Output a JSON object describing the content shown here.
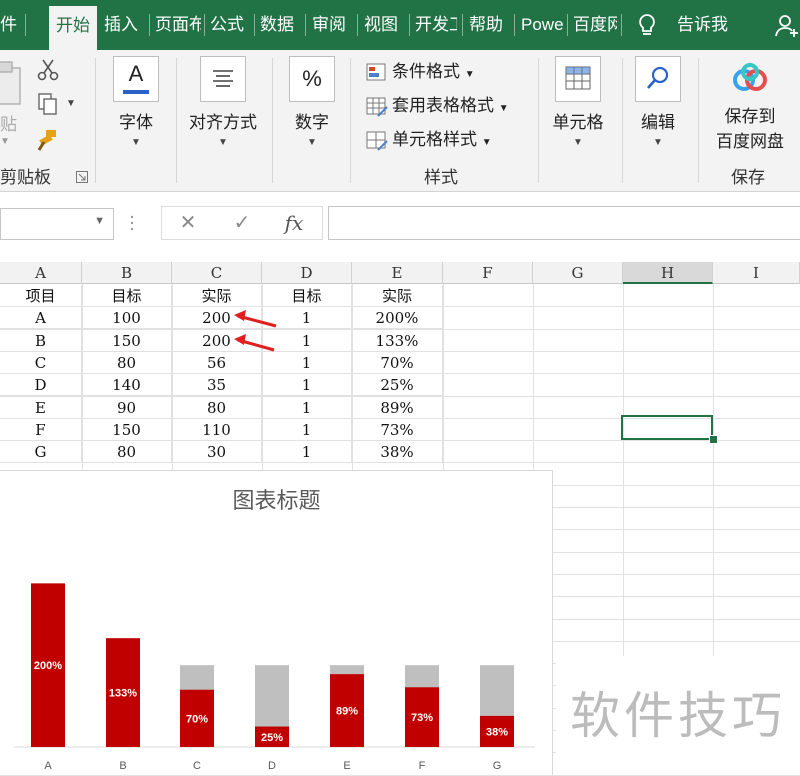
{
  "ribbon_tabs": [
    "件",
    "开始",
    "插入",
    "页面布",
    "公式",
    "数据",
    "审阅",
    "视图",
    "开发工",
    "帮助",
    "Powe",
    "百度网",
    "告诉我"
  ],
  "active_tab_index": 1,
  "tell_me_icon": "lightbulb-icon",
  "account_icon": "person-add-icon",
  "ribbon": {
    "clipboard": {
      "paste_label": "贴",
      "group_label": "剪贴板",
      "cut_icon": "scissors-icon",
      "copy_icon": "copy-icon",
      "format_painter_icon": "brush-icon",
      "launcher_icon": "dialog-launcher-icon"
    },
    "font": {
      "label": "字体",
      "icon_text": "A"
    },
    "alignment": {
      "label": "对齐方式"
    },
    "number": {
      "label": "数字",
      "icon_text": "%"
    },
    "styles": {
      "conditional_formatting": "条件格式",
      "format_as_table": "套用表格格式",
      "cell_styles": "单元格样式",
      "group_label": "样式"
    },
    "cells": {
      "label": "单元格"
    },
    "editing": {
      "label": "编辑"
    },
    "save": {
      "label_line1": "保存到",
      "label_line2": "百度网盘",
      "group_label": "保存"
    }
  },
  "formula_bar": {
    "name_box": "",
    "cancel": "✕",
    "enter": "✓",
    "fx": "fx",
    "formula": ""
  },
  "columns": [
    "A",
    "B",
    "C",
    "D",
    "E",
    "F",
    "G",
    "H",
    "I"
  ],
  "selected_column": "H",
  "table": {
    "headers": [
      "项目",
      "目标",
      "实际",
      "目标",
      "实际"
    ],
    "rows": [
      [
        "A",
        "100",
        "200",
        "1",
        "200%"
      ],
      [
        "B",
        "150",
        "200",
        "1",
        "133%"
      ],
      [
        "C",
        "80",
        "56",
        "1",
        "70%"
      ],
      [
        "D",
        "140",
        "35",
        "1",
        "25%"
      ],
      [
        "E",
        "90",
        "80",
        "1",
        "89%"
      ],
      [
        "F",
        "150",
        "110",
        "1",
        "73%"
      ],
      [
        "G",
        "80",
        "30",
        "1",
        "38%"
      ]
    ]
  },
  "chart_data": {
    "type": "bar",
    "title": "图表标题",
    "categories": [
      "A",
      "B",
      "C",
      "D",
      "E",
      "F",
      "G"
    ],
    "series": [
      {
        "name": "目标",
        "values": [
          1,
          1,
          1,
          1,
          1,
          1,
          1
        ],
        "color": "#bfbfbf"
      },
      {
        "name": "实际",
        "values": [
          2.0,
          1.33,
          0.7,
          0.25,
          0.89,
          0.73,
          0.38
        ],
        "color": "#c00000"
      }
    ],
    "data_labels": [
      "200%",
      "133%",
      "70%",
      "25%",
      "89%",
      "73%",
      "38%"
    ],
    "ylim": [
      0,
      2.2
    ],
    "grid": false,
    "legend": "none"
  },
  "watermark": "软件技巧",
  "colors": {
    "excel_green": "#217346",
    "arrow_red": "#e02020"
  }
}
